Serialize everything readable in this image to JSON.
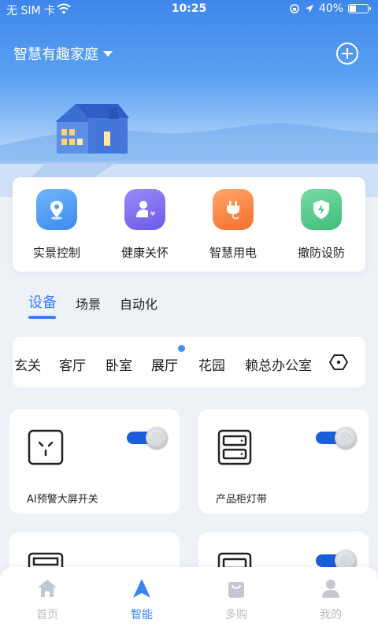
{
  "status_bar": {
    "carrier": "无 SIM 卡",
    "time": "10:25",
    "battery_text": "40%",
    "battery_level": 0.4
  },
  "header": {
    "home_name": "智慧有趣家庭"
  },
  "quick_actions": [
    {
      "label": "实景控制",
      "icon": "location-pin-icon",
      "color": "#4d9ef5"
    },
    {
      "label": "健康关怀",
      "icon": "user-heart-icon",
      "color": "#7b6cf2"
    },
    {
      "label": "智慧用电",
      "icon": "power-plug-icon",
      "color": "#f9823a"
    },
    {
      "label": "撤防设防",
      "icon": "shield-icon",
      "color": "#4fc88a"
    }
  ],
  "tabs": [
    {
      "label": "设备",
      "active": true
    },
    {
      "label": "场景",
      "active": false
    },
    {
      "label": "自动化",
      "active": false
    }
  ],
  "rooms": [
    {
      "label": "玄关"
    },
    {
      "label": "客厅"
    },
    {
      "label": "卧室"
    },
    {
      "label": "展厅",
      "active": true
    },
    {
      "label": "花园"
    },
    {
      "label": "赖总办公室"
    }
  ],
  "devices": [
    {
      "name": "AI预警大屏开关",
      "icon": "socket-icon",
      "on": true
    },
    {
      "name": "产品柜灯带",
      "icon": "cabinet-icon",
      "on": true
    },
    {
      "name": "",
      "icon": "panel-icon",
      "on": false
    },
    {
      "name": "",
      "icon": "cabinet-icon",
      "on": true
    }
  ],
  "bottom_nav": [
    {
      "label": "首页",
      "icon": "home-icon"
    },
    {
      "label": "智能",
      "icon": "navigate-arrow-icon",
      "active": true
    },
    {
      "label": "多购",
      "icon": "shopping-bag-icon"
    },
    {
      "label": "我的",
      "icon": "person-icon"
    }
  ],
  "colors": {
    "accent": "#3b82f6",
    "toggle_on": "#1a5fd8"
  }
}
